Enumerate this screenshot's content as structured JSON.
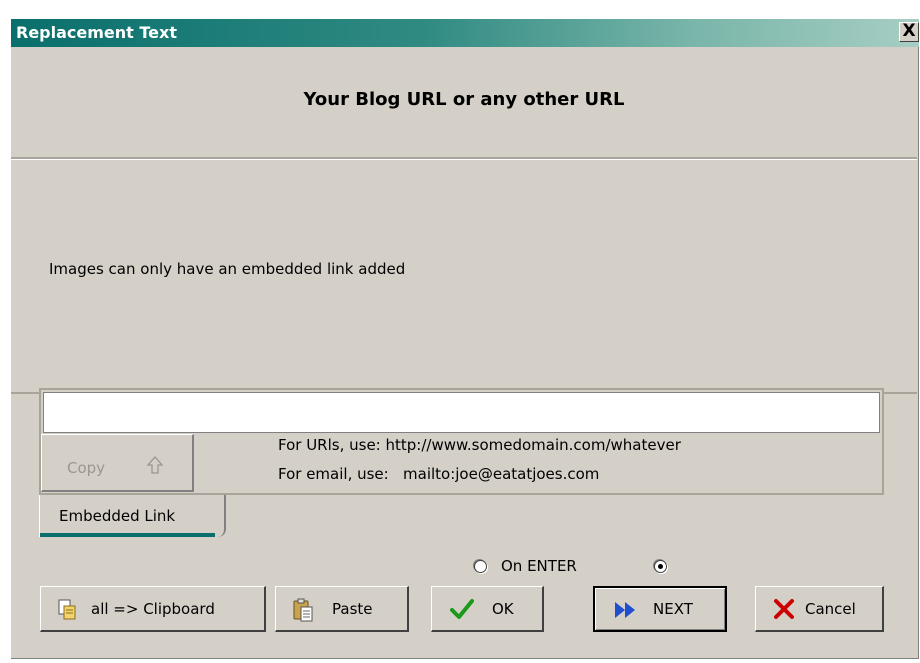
{
  "window": {
    "title": "Replacement Text",
    "close_label": "X"
  },
  "header": {
    "title": "Your Blog URL or any other URL"
  },
  "info": {
    "message": "Images can only have an embedded link added"
  },
  "link": {
    "value": "",
    "copy_label": "Copy",
    "hint_url": "For URls, use: http://www.somedomain.com/whatever",
    "hint_email": "For email, use:   mailto:joe@eatatjoes.com",
    "tab_label": "Embedded Link"
  },
  "radios": {
    "on_enter_label": "On ENTER",
    "on_enter_checked": false,
    "second_checked": true
  },
  "buttons": {
    "clipboard_label": "all => Clipboard",
    "paste_label": "Paste",
    "ok_label": "OK",
    "next_label": "NEXT",
    "cancel_label": "Cancel"
  },
  "colors": {
    "title_bar": "#0a6f6c",
    "ok_check": "#1a9a1a",
    "next_arrow": "#1f4fd0",
    "cancel_x": "#cc0000"
  }
}
